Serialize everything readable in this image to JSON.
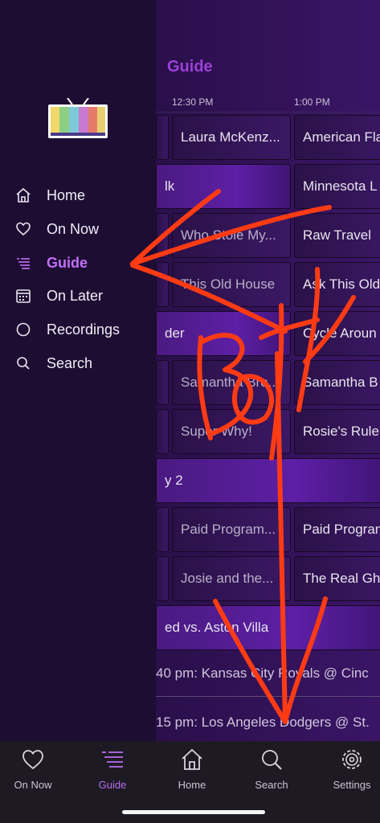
{
  "guide": {
    "title": "Guide",
    "times": [
      "12:30 PM",
      "1:00 PM"
    ],
    "rows": [
      {
        "left": "",
        "mid": "Laura McKenz...",
        "right": "American Fla"
      },
      {
        "wide_left": "lk",
        "right": "Minnesota L"
      },
      {
        "left": "",
        "mid": "Who Stole My...",
        "right": "Raw Travel"
      },
      {
        "left": "",
        "mid": "This Old House",
        "right": "Ask This Old"
      },
      {
        "wide_left": "der",
        "right": "Cycle Aroun"
      },
      {
        "left": "",
        "mid": "Samantha Bro...",
        "right": "Samantha B"
      },
      {
        "left": "",
        "mid": "Super Why!",
        "right": "Rosie's Rule"
      },
      {
        "wide_left": "y 2",
        "right": ""
      },
      {
        "left": "",
        "mid": "Paid Program...",
        "right": "Paid Program"
      },
      {
        "left": "",
        "mid": "Josie and the...",
        "right": "The Real Gh"
      },
      {
        "wide_left": "ed vs. Aston Villa",
        "right": ""
      }
    ],
    "sub_items": [
      "40 pm: Kansas City Royals @ Cinc",
      "15 pm: Los Angeles Dodgers @ St."
    ]
  },
  "drawer": {
    "items": [
      {
        "label": "Home",
        "icon": "home-icon"
      },
      {
        "label": "On Now",
        "icon": "heart-icon"
      },
      {
        "label": "Guide",
        "icon": "list-icon",
        "active": true
      },
      {
        "label": "On Later",
        "icon": "calendar-icon"
      },
      {
        "label": "Recordings",
        "icon": "circle-icon"
      },
      {
        "label": "Search",
        "icon": "search-icon"
      }
    ]
  },
  "tabbar": {
    "tabs": [
      {
        "label": "On Now",
        "icon": "heart-icon"
      },
      {
        "label": "Guide",
        "icon": "list-icon",
        "active": true
      },
      {
        "label": "Home",
        "icon": "home-icon"
      },
      {
        "label": "Search",
        "icon": "search-icon"
      },
      {
        "label": "Settings",
        "icon": "gear-icon"
      }
    ]
  },
  "colors": {
    "accent": "#b770f0",
    "annotation": "#ff3b14",
    "drawer_bg": "#1e0d33"
  }
}
